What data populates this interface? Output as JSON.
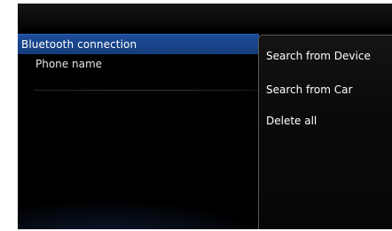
{
  "left_panel": {
    "header": "Bluetooth connection",
    "rows": [
      {
        "label": "Phone name"
      }
    ]
  },
  "menu": {
    "items": [
      {
        "label": "Search from Device"
      },
      {
        "label": "Search from Car"
      },
      {
        "label": "Delete all"
      }
    ]
  }
}
